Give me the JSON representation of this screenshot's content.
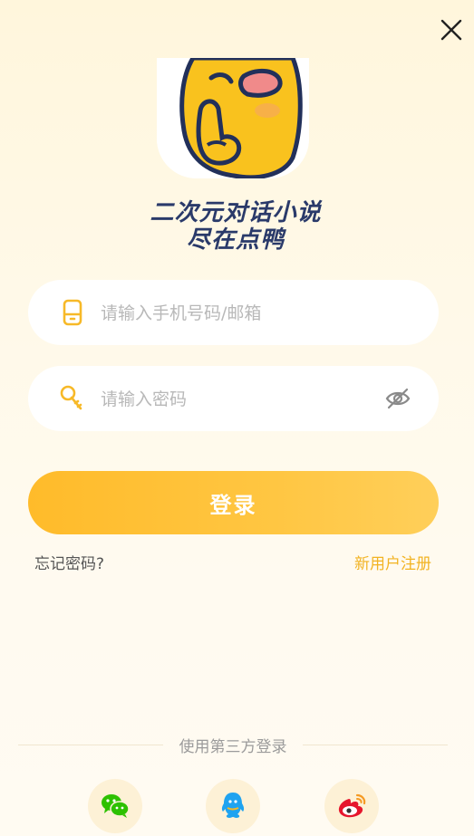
{
  "slogan": {
    "line1": "二次元对话小说",
    "line2": "尽在点鸭"
  },
  "form": {
    "account_placeholder": "请输入手机号码/邮箱",
    "password_placeholder": "请输入密码"
  },
  "buttons": {
    "login_label": "登录",
    "forgot_label": "忘记密码?",
    "register_label": "新用户注册"
  },
  "third_party": {
    "label": "使用第三方登录",
    "providers": [
      "wechat",
      "qq",
      "weibo"
    ]
  },
  "icons": {
    "close": "close-icon",
    "phone": "phone-icon",
    "key": "key-icon",
    "eye": "eye-hidden-icon"
  },
  "colors": {
    "accent": "#ffc02e",
    "link": "#f2b322",
    "wechat": "#2dc100",
    "qq": "#1fa3f0",
    "weibo": "#e6162d"
  }
}
